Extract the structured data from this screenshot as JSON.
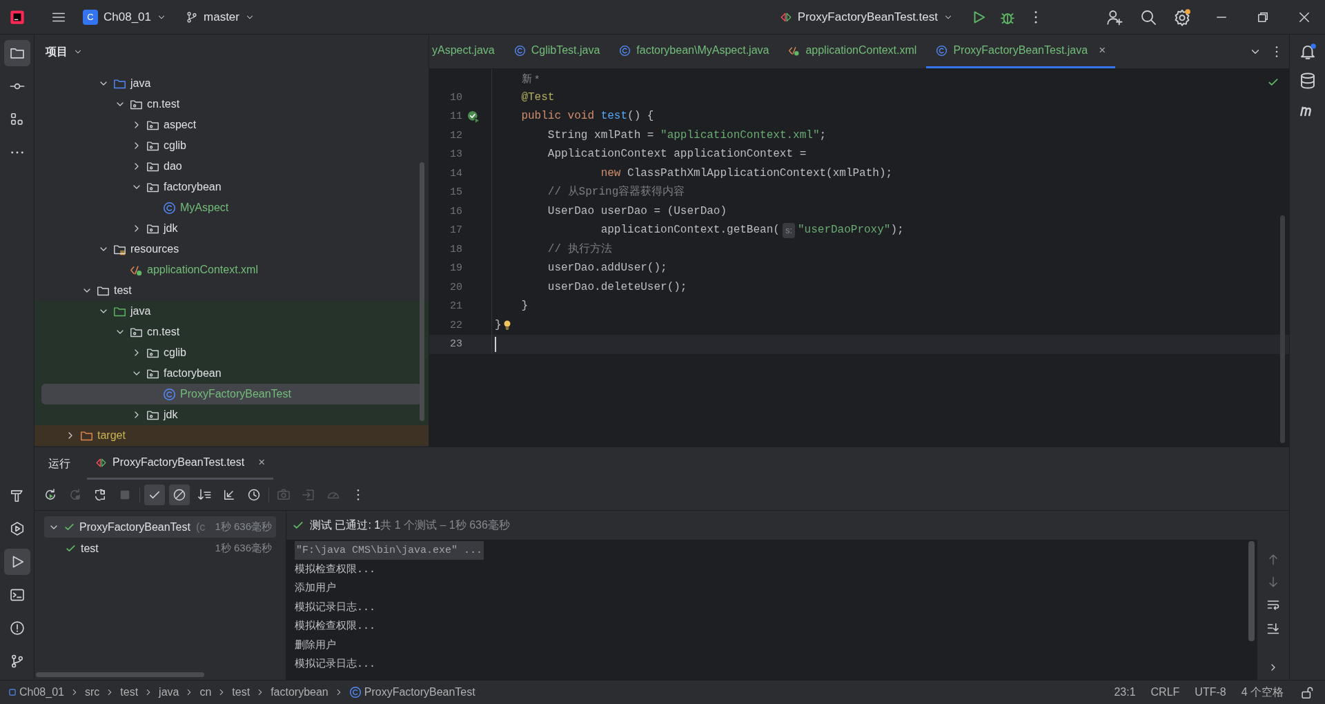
{
  "title_bar": {
    "project_badge": "C",
    "project": "Ch08_01",
    "branch": "master",
    "run_config": "ProxyFactoryBeanTest.test"
  },
  "left_toolbar": {
    "top": [
      {
        "kind": "project",
        "selected": true
      },
      {
        "kind": "commit",
        "selected": false
      },
      {
        "kind": "structure",
        "selected": false
      },
      {
        "kind": "more",
        "selected": false
      }
    ],
    "bottom": [
      {
        "kind": "build",
        "selected": false
      },
      {
        "kind": "services",
        "selected": false
      },
      {
        "kind": "run",
        "selected": true
      },
      {
        "kind": "terminal",
        "selected": false
      },
      {
        "kind": "problems",
        "selected": false
      },
      {
        "kind": "git",
        "selected": false
      }
    ]
  },
  "project_panel": {
    "title": "项目",
    "tree": [
      {
        "kind": "hidden",
        "children": [
          {
            "kind": "hidden",
            "children": [
              {
                "label": "java",
                "kind": "source-root",
                "expanded": true,
                "selected": false,
                "children": [
                  {
                    "label": "cn.test",
                    "kind": "package",
                    "expanded": true,
                    "selected": false,
                    "children": [
                      {
                        "label": "aspect",
                        "kind": "package",
                        "expanded": false,
                        "selected": false
                      },
                      {
                        "label": "cglib",
                        "kind": "package",
                        "expanded": false,
                        "selected": false
                      },
                      {
                        "label": "dao",
                        "kind": "package",
                        "expanded": false,
                        "selected": false
                      },
                      {
                        "label": "factorybean",
                        "kind": "package",
                        "expanded": true,
                        "selected": false,
                        "children": [
                          {
                            "label": "MyAspect",
                            "kind": "class",
                            "color": "#73bd79",
                            "selected": false
                          }
                        ]
                      },
                      {
                        "label": "jdk",
                        "kind": "package",
                        "expanded": false,
                        "selected": false
                      }
                    ]
                  }
                ]
              },
              {
                "label": "resources",
                "kind": "resources-root",
                "expanded": true,
                "selected": false,
                "children": [
                  {
                    "label": "applicationContext.xml",
                    "kind": "xml",
                    "color": "#73bd79",
                    "selected": false
                  }
                ]
              }
            ]
          },
          {
            "label": "test",
            "kind": "folder",
            "expanded": true,
            "selected": false,
            "children": [
              {
                "label": "java",
                "kind": "test-root",
                "expanded": true,
                "selected": false,
                "children": [
                  {
                    "label": "cn.test",
                    "kind": "package",
                    "expanded": true,
                    "selected": false,
                    "children": [
                      {
                        "label": "cglib",
                        "kind": "package",
                        "expanded": false,
                        "selected": false
                      },
                      {
                        "label": "factorybean",
                        "kind": "package",
                        "expanded": true,
                        "selected": false,
                        "children": [
                          {
                            "label": "ProxyFactoryBeanTest",
                            "kind": "class",
                            "color": "#73bd79",
                            "selected": true
                          }
                        ]
                      },
                      {
                        "label": "jdk",
                        "kind": "package",
                        "expanded": false,
                        "selected": false
                      }
                    ]
                  }
                ]
              }
            ]
          }
        ]
      },
      {
        "label": "target",
        "kind": "excluded",
        "expanded": false,
        "selected": false
      }
    ]
  },
  "editor": {
    "tabs": [
      {
        "label": "yAspect.java",
        "kind": "cut",
        "selected": false
      },
      {
        "label": "CglibTest.java",
        "kind": "class",
        "selected": false
      },
      {
        "label": "factorybean\\MyAspect.java",
        "kind": "class",
        "selected": false
      },
      {
        "label": "applicationContext.xml",
        "kind": "xml",
        "selected": false
      },
      {
        "label": "ProxyFactoryBeanTest.java",
        "kind": "class",
        "selected": true,
        "close": "×"
      }
    ],
    "usage_hint": "新 *",
    "lines": [
      {
        "number": "10",
        "current": false,
        "tokens": [
          {
            "text": "    @Test",
            "kind": "annotation"
          }
        ]
      },
      {
        "number": "11",
        "current": false,
        "kind": "run-passed",
        "tokens": [
          {
            "text": "    public void ",
            "kind": "keyword"
          },
          {
            "text": "test",
            "kind": "method"
          },
          {
            "text": "() {",
            "kind": "plain"
          }
        ]
      },
      {
        "number": "12",
        "current": false,
        "tokens": [
          {
            "text": "        String xmlPath = ",
            "kind": "plain"
          },
          {
            "text": "\"applicationContext.xml\"",
            "kind": "string"
          },
          {
            "text": ";",
            "kind": "plain"
          }
        ]
      },
      {
        "number": "13",
        "current": false,
        "tokens": [
          {
            "text": "        ApplicationContext applicationContext =",
            "kind": "plain"
          }
        ]
      },
      {
        "number": "14",
        "current": false,
        "tokens": [
          {
            "text": "                new ",
            "kind": "keyword"
          },
          {
            "text": "ClassPathXmlApplicationContext(xmlPath);",
            "kind": "plain"
          }
        ]
      },
      {
        "number": "15",
        "current": false,
        "tokens": [
          {
            "text": "        // 从Spring容器获得内容",
            "kind": "comment"
          }
        ]
      },
      {
        "number": "16",
        "current": false,
        "tokens": [
          {
            "text": "        UserDao userDao = (UserDao)",
            "kind": "plain"
          }
        ]
      },
      {
        "number": "17",
        "current": false,
        "tokens": [
          {
            "text": "                applicationContext.getBean(",
            "kind": "plain"
          },
          {
            "text": "s:",
            "kind": "hint"
          },
          {
            "text": "\"userDaoProxy\"",
            "kind": "string"
          },
          {
            "text": ");",
            "kind": "plain"
          }
        ]
      },
      {
        "number": "18",
        "current": false,
        "tokens": [
          {
            "text": "        // 执行方法",
            "kind": "comment"
          }
        ]
      },
      {
        "number": "19",
        "current": false,
        "tokens": [
          {
            "text": "        userDao.addUser();",
            "kind": "plain"
          }
        ]
      },
      {
        "number": "20",
        "current": false,
        "tokens": [
          {
            "text": "        userDao.deleteUser();",
            "kind": "plain"
          }
        ]
      },
      {
        "number": "21",
        "current": false,
        "tokens": [
          {
            "text": "    }",
            "kind": "plain"
          }
        ]
      },
      {
        "number": "22",
        "current": false,
        "kind": "bulb",
        "tokens": [
          {
            "text": "}",
            "kind": "plain"
          }
        ]
      },
      {
        "number": "23",
        "current": true
      }
    ]
  },
  "run_panel": {
    "title": "运行",
    "tabs": [
      {
        "label": "ProxyFactoryBeanTest.test",
        "selected": true,
        "close": "×"
      }
    ],
    "toolbar": [
      {
        "kind": "rerun",
        "on": false,
        "disabled": false
      },
      {
        "kind": "rerun-failed",
        "on": false,
        "disabled": true
      },
      {
        "kind": "toggle-auto",
        "on": false,
        "disabled": false
      },
      {
        "kind": "stop",
        "on": false,
        "disabled": true
      },
      {
        "kind": "show-passed",
        "on": true,
        "disabled": false
      },
      {
        "kind": "show-ignored",
        "on": true,
        "disabled": false
      },
      {
        "kind": "sort",
        "on": false,
        "disabled": false
      },
      {
        "kind": "collapse",
        "on": false,
        "disabled": false
      },
      {
        "kind": "history",
        "on": false,
        "disabled": false
      },
      {
        "kind": "camera",
        "on": false,
        "disabled": true
      },
      {
        "kind": "export",
        "on": false,
        "disabled": true
      },
      {
        "kind": "gauge",
        "on": false,
        "disabled": true
      },
      {
        "kind": "more",
        "on": false,
        "disabled": false
      }
    ],
    "tests": [
      {
        "label": "ProxyFactoryBeanTest",
        "suffix": "(c",
        "time": "1秒 636毫秒",
        "passed": true,
        "expanded": true,
        "selected": true,
        "children": [
          {
            "label": "test",
            "time": "1秒 636毫秒",
            "passed": true,
            "selected": false
          }
        ]
      }
    ],
    "summary": {
      "passed": true,
      "result": "测试 已通过: 1",
      "detail": "共 1 个测试 – 1秒 636毫秒"
    },
    "console": [
      {
        "kind": "command",
        "text": "\"F:\\java CMS\\bin\\java.exe\" ..."
      },
      {
        "kind": "output",
        "text": "模拟检查权限..."
      },
      {
        "kind": "output",
        "text": "添加用户"
      },
      {
        "kind": "output",
        "text": "模拟记录日志..."
      },
      {
        "kind": "output",
        "text": "模拟检查权限..."
      },
      {
        "kind": "output",
        "text": "删除用户"
      },
      {
        "kind": "output",
        "text": "模拟记录日志..."
      }
    ]
  },
  "right_toolbar": [
    {
      "kind": "notifications"
    },
    {
      "kind": "database"
    },
    {
      "kind": "maven"
    }
  ],
  "status_bar": {
    "breadcrumbs": [
      {
        "label": "Ch08_01",
        "kind": "module"
      },
      {
        "label": "src",
        "kind": "folder"
      },
      {
        "label": "test",
        "kind": "folder"
      },
      {
        "label": "java",
        "kind": "folder"
      },
      {
        "label": "cn",
        "kind": "folder"
      },
      {
        "label": "test",
        "kind": "folder"
      },
      {
        "label": "factorybean",
        "kind": "folder"
      },
      {
        "label": "ProxyFactoryBeanTest",
        "kind": "class"
      }
    ],
    "items": [
      "23:1",
      "CRLF",
      "UTF-8",
      "4 个空格"
    ]
  }
}
